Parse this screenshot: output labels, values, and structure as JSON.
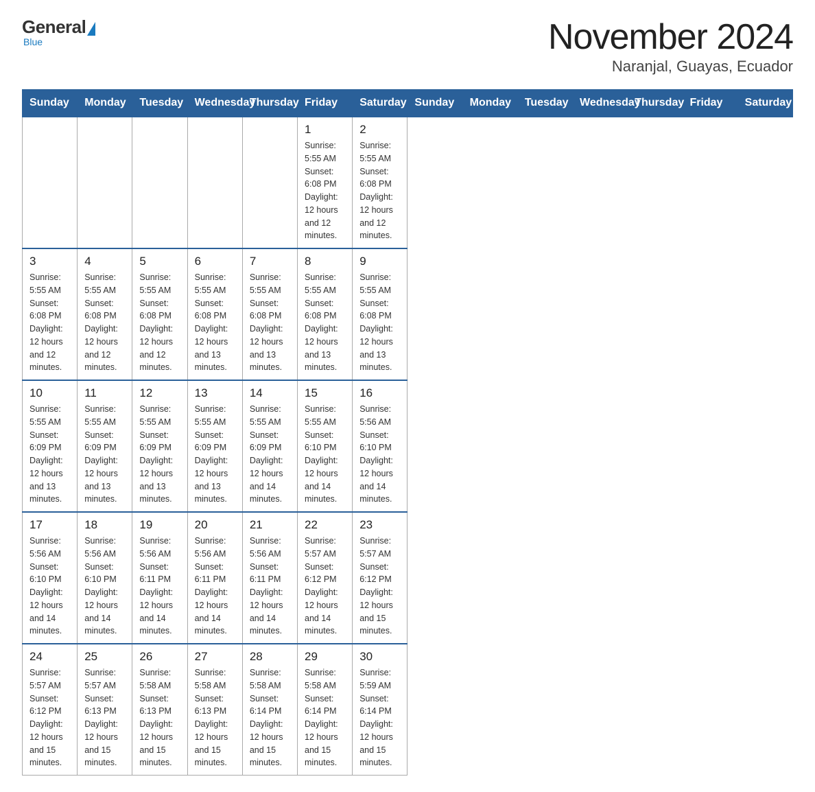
{
  "logo": {
    "general": "General",
    "blue": "Blue",
    "subtitle": "Blue"
  },
  "title": "November 2024",
  "location": "Naranjal, Guayas, Ecuador",
  "days_of_week": [
    "Sunday",
    "Monday",
    "Tuesday",
    "Wednesday",
    "Thursday",
    "Friday",
    "Saturday"
  ],
  "weeks": [
    [
      {
        "day": "",
        "info": ""
      },
      {
        "day": "",
        "info": ""
      },
      {
        "day": "",
        "info": ""
      },
      {
        "day": "",
        "info": ""
      },
      {
        "day": "",
        "info": ""
      },
      {
        "day": "1",
        "info": "Sunrise: 5:55 AM\nSunset: 6:08 PM\nDaylight: 12 hours\nand 12 minutes."
      },
      {
        "day": "2",
        "info": "Sunrise: 5:55 AM\nSunset: 6:08 PM\nDaylight: 12 hours\nand 12 minutes."
      }
    ],
    [
      {
        "day": "3",
        "info": "Sunrise: 5:55 AM\nSunset: 6:08 PM\nDaylight: 12 hours\nand 12 minutes."
      },
      {
        "day": "4",
        "info": "Sunrise: 5:55 AM\nSunset: 6:08 PM\nDaylight: 12 hours\nand 12 minutes."
      },
      {
        "day": "5",
        "info": "Sunrise: 5:55 AM\nSunset: 6:08 PM\nDaylight: 12 hours\nand 12 minutes."
      },
      {
        "day": "6",
        "info": "Sunrise: 5:55 AM\nSunset: 6:08 PM\nDaylight: 12 hours\nand 13 minutes."
      },
      {
        "day": "7",
        "info": "Sunrise: 5:55 AM\nSunset: 6:08 PM\nDaylight: 12 hours\nand 13 minutes."
      },
      {
        "day": "8",
        "info": "Sunrise: 5:55 AM\nSunset: 6:08 PM\nDaylight: 12 hours\nand 13 minutes."
      },
      {
        "day": "9",
        "info": "Sunrise: 5:55 AM\nSunset: 6:08 PM\nDaylight: 12 hours\nand 13 minutes."
      }
    ],
    [
      {
        "day": "10",
        "info": "Sunrise: 5:55 AM\nSunset: 6:09 PM\nDaylight: 12 hours\nand 13 minutes."
      },
      {
        "day": "11",
        "info": "Sunrise: 5:55 AM\nSunset: 6:09 PM\nDaylight: 12 hours\nand 13 minutes."
      },
      {
        "day": "12",
        "info": "Sunrise: 5:55 AM\nSunset: 6:09 PM\nDaylight: 12 hours\nand 13 minutes."
      },
      {
        "day": "13",
        "info": "Sunrise: 5:55 AM\nSunset: 6:09 PM\nDaylight: 12 hours\nand 13 minutes."
      },
      {
        "day": "14",
        "info": "Sunrise: 5:55 AM\nSunset: 6:09 PM\nDaylight: 12 hours\nand 14 minutes."
      },
      {
        "day": "15",
        "info": "Sunrise: 5:55 AM\nSunset: 6:10 PM\nDaylight: 12 hours\nand 14 minutes."
      },
      {
        "day": "16",
        "info": "Sunrise: 5:56 AM\nSunset: 6:10 PM\nDaylight: 12 hours\nand 14 minutes."
      }
    ],
    [
      {
        "day": "17",
        "info": "Sunrise: 5:56 AM\nSunset: 6:10 PM\nDaylight: 12 hours\nand 14 minutes."
      },
      {
        "day": "18",
        "info": "Sunrise: 5:56 AM\nSunset: 6:10 PM\nDaylight: 12 hours\nand 14 minutes."
      },
      {
        "day": "19",
        "info": "Sunrise: 5:56 AM\nSunset: 6:11 PM\nDaylight: 12 hours\nand 14 minutes."
      },
      {
        "day": "20",
        "info": "Sunrise: 5:56 AM\nSunset: 6:11 PM\nDaylight: 12 hours\nand 14 minutes."
      },
      {
        "day": "21",
        "info": "Sunrise: 5:56 AM\nSunset: 6:11 PM\nDaylight: 12 hours\nand 14 minutes."
      },
      {
        "day": "22",
        "info": "Sunrise: 5:57 AM\nSunset: 6:12 PM\nDaylight: 12 hours\nand 14 minutes."
      },
      {
        "day": "23",
        "info": "Sunrise: 5:57 AM\nSunset: 6:12 PM\nDaylight: 12 hours\nand 15 minutes."
      }
    ],
    [
      {
        "day": "24",
        "info": "Sunrise: 5:57 AM\nSunset: 6:12 PM\nDaylight: 12 hours\nand 15 minutes."
      },
      {
        "day": "25",
        "info": "Sunrise: 5:57 AM\nSunset: 6:13 PM\nDaylight: 12 hours\nand 15 minutes."
      },
      {
        "day": "26",
        "info": "Sunrise: 5:58 AM\nSunset: 6:13 PM\nDaylight: 12 hours\nand 15 minutes."
      },
      {
        "day": "27",
        "info": "Sunrise: 5:58 AM\nSunset: 6:13 PM\nDaylight: 12 hours\nand 15 minutes."
      },
      {
        "day": "28",
        "info": "Sunrise: 5:58 AM\nSunset: 6:14 PM\nDaylight: 12 hours\nand 15 minutes."
      },
      {
        "day": "29",
        "info": "Sunrise: 5:58 AM\nSunset: 6:14 PM\nDaylight: 12 hours\nand 15 minutes."
      },
      {
        "day": "30",
        "info": "Sunrise: 5:59 AM\nSunset: 6:14 PM\nDaylight: 12 hours\nand 15 minutes."
      }
    ]
  ],
  "colors": {
    "header_bg": "#2a6099",
    "header_text": "#ffffff",
    "border": "#aaaaaa",
    "top_border": "#2a6099"
  }
}
